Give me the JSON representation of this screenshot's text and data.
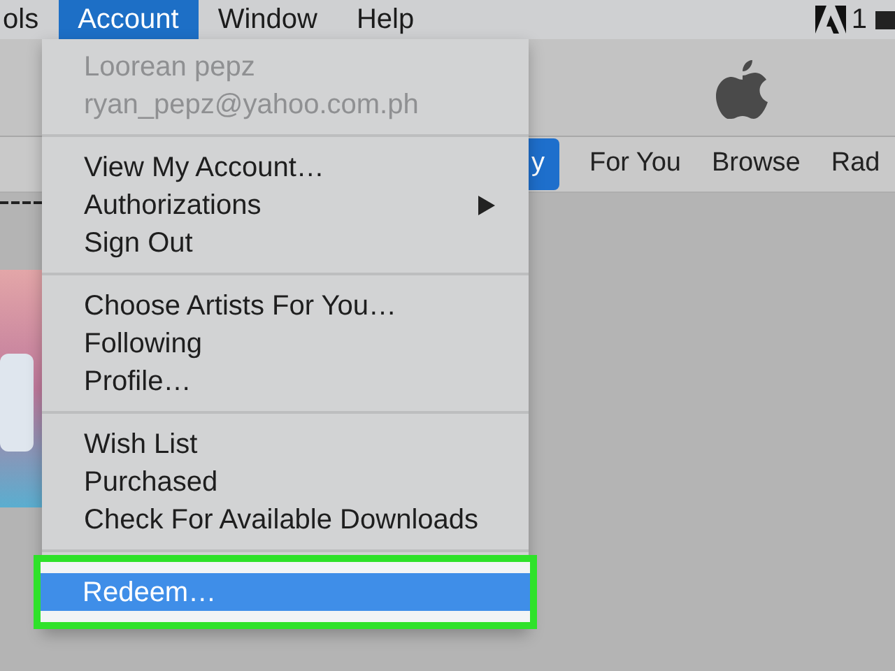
{
  "menu_bar": {
    "items": [
      {
        "label": "ols",
        "selected": false
      },
      {
        "label": "Account",
        "selected": true
      },
      {
        "label": "Window",
        "selected": false
      },
      {
        "label": "Help",
        "selected": false
      }
    ],
    "status_count": "1"
  },
  "toolbar": {
    "tabs": [
      {
        "label": "y",
        "selected": true
      },
      {
        "label": "For You",
        "selected": false
      },
      {
        "label": "Browse",
        "selected": false
      },
      {
        "label": "Rad",
        "selected": false
      }
    ]
  },
  "account_menu": {
    "sections": [
      {
        "items": [
          {
            "label": "Loorean pepz",
            "disabled": true,
            "selected": false,
            "submenu": false,
            "highlighted": false
          },
          {
            "label": "ryan_pepz@yahoo.com.ph",
            "disabled": true,
            "selected": false,
            "submenu": false,
            "highlighted": false
          }
        ]
      },
      {
        "items": [
          {
            "label": "View My Account…",
            "disabled": false,
            "selected": false,
            "submenu": false,
            "highlighted": false
          },
          {
            "label": "Authorizations",
            "disabled": false,
            "selected": false,
            "submenu": true,
            "highlighted": false
          },
          {
            "label": "Sign Out",
            "disabled": false,
            "selected": false,
            "submenu": false,
            "highlighted": false
          }
        ]
      },
      {
        "items": [
          {
            "label": "Choose Artists For You…",
            "disabled": false,
            "selected": false,
            "submenu": false,
            "highlighted": false
          },
          {
            "label": "Following",
            "disabled": false,
            "selected": false,
            "submenu": false,
            "highlighted": false
          },
          {
            "label": "Profile…",
            "disabled": false,
            "selected": false,
            "submenu": false,
            "highlighted": false
          }
        ]
      },
      {
        "items": [
          {
            "label": "Wish List",
            "disabled": false,
            "selected": false,
            "submenu": false,
            "highlighted": false
          },
          {
            "label": "Purchased",
            "disabled": false,
            "selected": false,
            "submenu": false,
            "highlighted": false
          },
          {
            "label": "Check For Available Downloads",
            "disabled": false,
            "selected": false,
            "submenu": false,
            "highlighted": false
          }
        ]
      },
      {
        "items": [
          {
            "label": "Redeem…",
            "disabled": false,
            "selected": true,
            "submenu": false,
            "highlighted": true
          }
        ]
      }
    ]
  }
}
